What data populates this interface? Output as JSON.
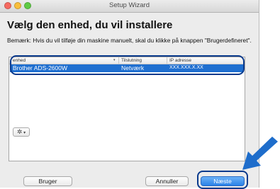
{
  "window": {
    "title": "Setup Wizard"
  },
  "heading": "Vælg den enhed, du vil installere",
  "note": "Bemærk: Hvis du vil tilføje din maskine manuelt, skal du klikke på knappen \"Brugerdefineret\".",
  "table": {
    "columns": [
      "enhed",
      "Tilslutning",
      "IP adresse"
    ],
    "rows": [
      {
        "device": "Brother ADS-2600W",
        "connection": "Netværk",
        "ip": "XXX.XXX.X.XX",
        "selected": true
      }
    ]
  },
  "gear_menu": {
    "icon": "gear-icon"
  },
  "buttons": {
    "custom": "Bruger",
    "cancel": "Annuller",
    "next": "Næste"
  },
  "colors": {
    "selection": "#1f6fd0",
    "callout": "#0b3a8c",
    "arrow": "#1e6dcb"
  }
}
